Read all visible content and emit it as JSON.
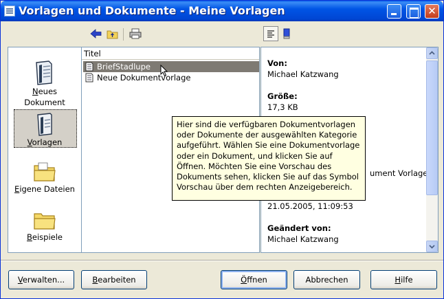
{
  "window": {
    "title": "Vorlagen und Dokumente - Meine Vorlagen"
  },
  "toolbar": {
    "icons": [
      "back-icon",
      "up-folder-icon",
      "print-icon",
      "document-properties-icon",
      "preview-icon"
    ]
  },
  "categories": [
    {
      "pre": "",
      "ul": "N",
      "post": "eues",
      "line2": "Dokument"
    },
    {
      "pre": "",
      "ul": "V",
      "post": "orlagen",
      "line2": ""
    },
    {
      "pre": "",
      "ul": "E",
      "post": "igene Dateien",
      "line2": ""
    },
    {
      "pre": "",
      "ul": "B",
      "post": "eispiele",
      "line2": ""
    }
  ],
  "list": {
    "header": "Titel",
    "items": [
      "BriefStadlupe",
      "Neue Dokumentvorlage"
    ]
  },
  "preview": {
    "von_label": "Von:",
    "von_value": "Michael Katzwang",
    "groesse_label": "Größe:",
    "groesse_value": "17,3 KB",
    "partial_type": "ument Vorlage",
    "date_value": "21.05.2005, 11:09:53",
    "geaendert_label": "Geändert von:",
    "geaendert_value": "Michael Katzwang"
  },
  "tooltip": {
    "lines": [
      "Hier sind die verfügbaren Dokumentvorlagen",
      "oder Dokumente der ausgewählten Kategorie",
      "aufgeführt. Wählen Sie eine Dokumentvorlage",
      "oder ein Dokument, und klicken Sie auf",
      "Öffnen. Möchten Sie eine Vorschau des",
      "Dokuments sehen, klicken Sie auf das Symbol",
      "Vorschau über dem rechten Anzeigebereich."
    ]
  },
  "buttons": {
    "verwalten": {
      "ul": "V",
      "rest": "erwalten..."
    },
    "bearbeiten": {
      "ul": "B",
      "rest": "earbeiten"
    },
    "oeffnen": {
      "ul": "Ö",
      "rest": "ffnen"
    },
    "abbrechen": "Abbrechen",
    "hilfe": {
      "ul": "H",
      "rest": "ilfe"
    }
  }
}
